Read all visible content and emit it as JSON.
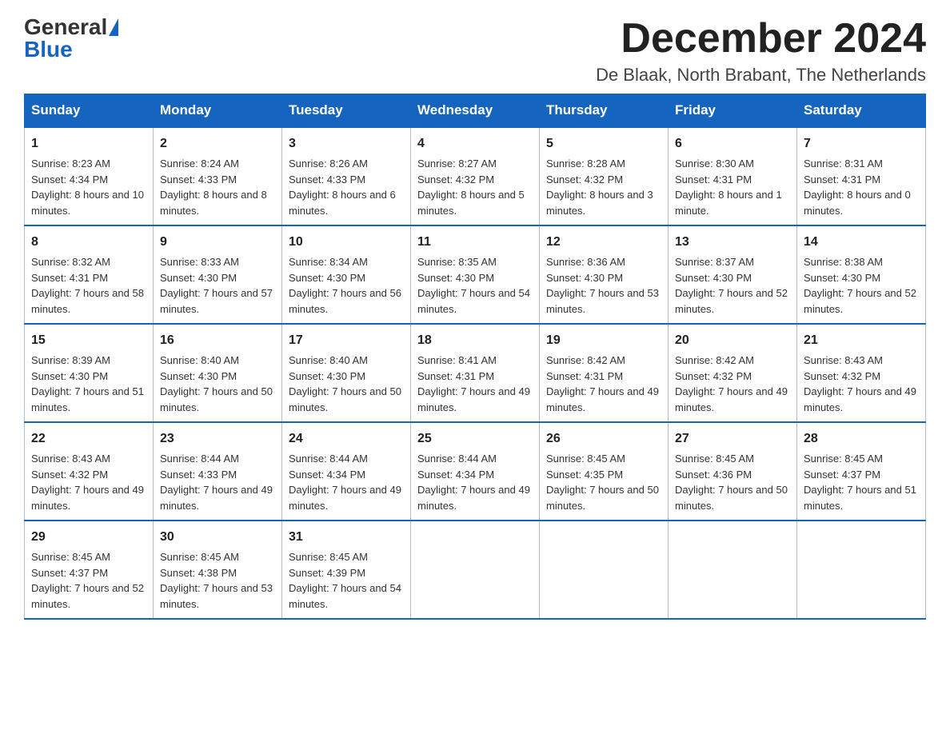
{
  "logo": {
    "general": "General",
    "blue": "Blue",
    "triangle": "▶"
  },
  "title": "December 2024",
  "location": "De Blaak, North Brabant, The Netherlands",
  "weekdays": [
    "Sunday",
    "Monday",
    "Tuesday",
    "Wednesday",
    "Thursday",
    "Friday",
    "Saturday"
  ],
  "weeks": [
    [
      {
        "day": "1",
        "sunrise": "8:23 AM",
        "sunset": "4:34 PM",
        "daylight": "8 hours and 10 minutes."
      },
      {
        "day": "2",
        "sunrise": "8:24 AM",
        "sunset": "4:33 PM",
        "daylight": "8 hours and 8 minutes."
      },
      {
        "day": "3",
        "sunrise": "8:26 AM",
        "sunset": "4:33 PM",
        "daylight": "8 hours and 6 minutes."
      },
      {
        "day": "4",
        "sunrise": "8:27 AM",
        "sunset": "4:32 PM",
        "daylight": "8 hours and 5 minutes."
      },
      {
        "day": "5",
        "sunrise": "8:28 AM",
        "sunset": "4:32 PM",
        "daylight": "8 hours and 3 minutes."
      },
      {
        "day": "6",
        "sunrise": "8:30 AM",
        "sunset": "4:31 PM",
        "daylight": "8 hours and 1 minute."
      },
      {
        "day": "7",
        "sunrise": "8:31 AM",
        "sunset": "4:31 PM",
        "daylight": "8 hours and 0 minutes."
      }
    ],
    [
      {
        "day": "8",
        "sunrise": "8:32 AM",
        "sunset": "4:31 PM",
        "daylight": "7 hours and 58 minutes."
      },
      {
        "day": "9",
        "sunrise": "8:33 AM",
        "sunset": "4:30 PM",
        "daylight": "7 hours and 57 minutes."
      },
      {
        "day": "10",
        "sunrise": "8:34 AM",
        "sunset": "4:30 PM",
        "daylight": "7 hours and 56 minutes."
      },
      {
        "day": "11",
        "sunrise": "8:35 AM",
        "sunset": "4:30 PM",
        "daylight": "7 hours and 54 minutes."
      },
      {
        "day": "12",
        "sunrise": "8:36 AM",
        "sunset": "4:30 PM",
        "daylight": "7 hours and 53 minutes."
      },
      {
        "day": "13",
        "sunrise": "8:37 AM",
        "sunset": "4:30 PM",
        "daylight": "7 hours and 52 minutes."
      },
      {
        "day": "14",
        "sunrise": "8:38 AM",
        "sunset": "4:30 PM",
        "daylight": "7 hours and 52 minutes."
      }
    ],
    [
      {
        "day": "15",
        "sunrise": "8:39 AM",
        "sunset": "4:30 PM",
        "daylight": "7 hours and 51 minutes."
      },
      {
        "day": "16",
        "sunrise": "8:40 AM",
        "sunset": "4:30 PM",
        "daylight": "7 hours and 50 minutes."
      },
      {
        "day": "17",
        "sunrise": "8:40 AM",
        "sunset": "4:30 PM",
        "daylight": "7 hours and 50 minutes."
      },
      {
        "day": "18",
        "sunrise": "8:41 AM",
        "sunset": "4:31 PM",
        "daylight": "7 hours and 49 minutes."
      },
      {
        "day": "19",
        "sunrise": "8:42 AM",
        "sunset": "4:31 PM",
        "daylight": "7 hours and 49 minutes."
      },
      {
        "day": "20",
        "sunrise": "8:42 AM",
        "sunset": "4:32 PM",
        "daylight": "7 hours and 49 minutes."
      },
      {
        "day": "21",
        "sunrise": "8:43 AM",
        "sunset": "4:32 PM",
        "daylight": "7 hours and 49 minutes."
      }
    ],
    [
      {
        "day": "22",
        "sunrise": "8:43 AM",
        "sunset": "4:32 PM",
        "daylight": "7 hours and 49 minutes."
      },
      {
        "day": "23",
        "sunrise": "8:44 AM",
        "sunset": "4:33 PM",
        "daylight": "7 hours and 49 minutes."
      },
      {
        "day": "24",
        "sunrise": "8:44 AM",
        "sunset": "4:34 PM",
        "daylight": "7 hours and 49 minutes."
      },
      {
        "day": "25",
        "sunrise": "8:44 AM",
        "sunset": "4:34 PM",
        "daylight": "7 hours and 49 minutes."
      },
      {
        "day": "26",
        "sunrise": "8:45 AM",
        "sunset": "4:35 PM",
        "daylight": "7 hours and 50 minutes."
      },
      {
        "day": "27",
        "sunrise": "8:45 AM",
        "sunset": "4:36 PM",
        "daylight": "7 hours and 50 minutes."
      },
      {
        "day": "28",
        "sunrise": "8:45 AM",
        "sunset": "4:37 PM",
        "daylight": "7 hours and 51 minutes."
      }
    ],
    [
      {
        "day": "29",
        "sunrise": "8:45 AM",
        "sunset": "4:37 PM",
        "daylight": "7 hours and 52 minutes."
      },
      {
        "day": "30",
        "sunrise": "8:45 AM",
        "sunset": "4:38 PM",
        "daylight": "7 hours and 53 minutes."
      },
      {
        "day": "31",
        "sunrise": "8:45 AM",
        "sunset": "4:39 PM",
        "daylight": "7 hours and 54 minutes."
      },
      null,
      null,
      null,
      null
    ]
  ]
}
